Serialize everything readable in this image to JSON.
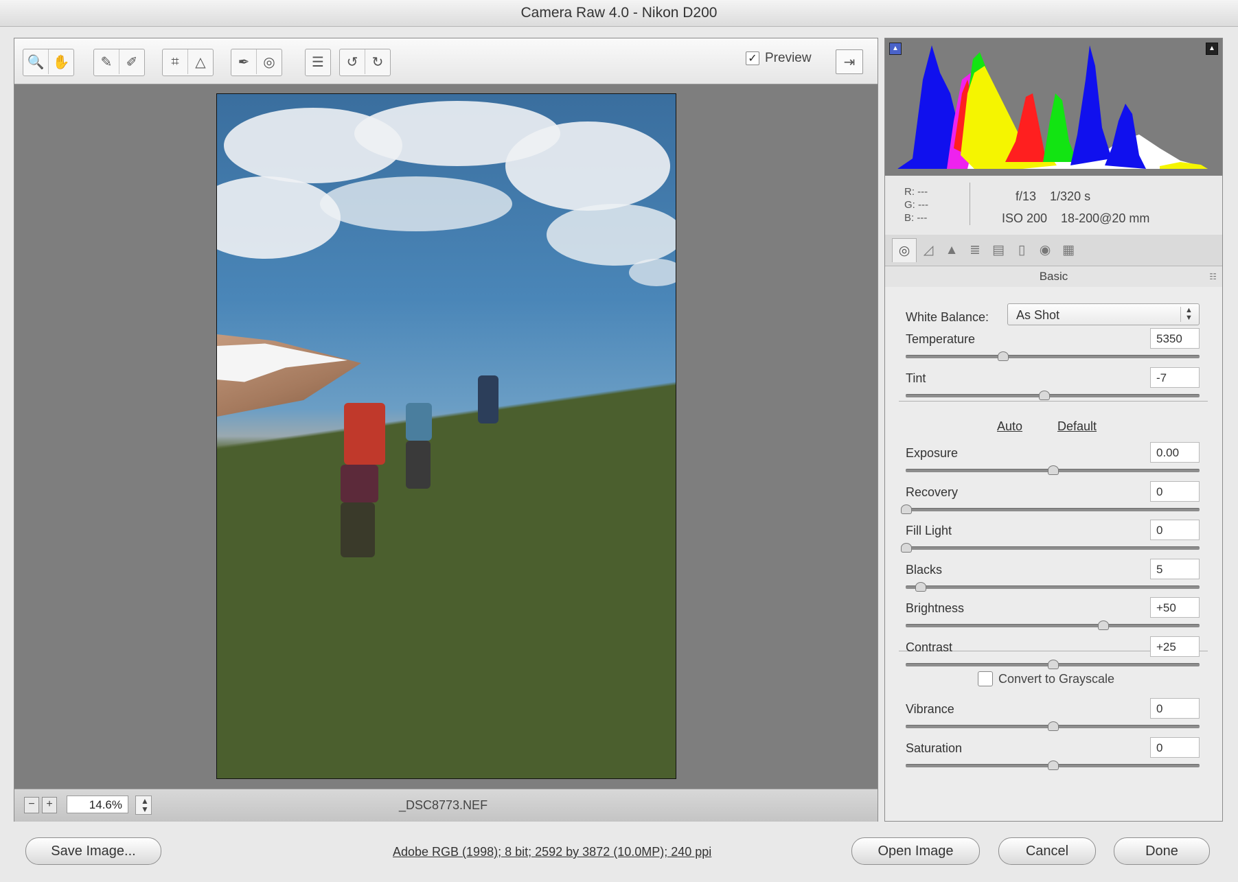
{
  "window": {
    "title": "Camera Raw 4.0  -  Nikon D200"
  },
  "toolbar": {
    "tools": [
      {
        "name": "zoom-tool-icon",
        "glyph": "🔍"
      },
      {
        "name": "hand-tool-icon",
        "glyph": "✋"
      },
      {
        "name": "white-balance-tool-icon",
        "glyph": "✎"
      },
      {
        "name": "color-sampler-tool-icon",
        "glyph": "✐"
      },
      {
        "name": "crop-tool-icon",
        "glyph": "⌗"
      },
      {
        "name": "straighten-tool-icon",
        "glyph": "△"
      },
      {
        "name": "retouch-tool-icon",
        "glyph": "✒"
      },
      {
        "name": "red-eye-tool-icon",
        "glyph": "◎"
      },
      {
        "name": "preferences-icon",
        "glyph": "☰"
      },
      {
        "name": "rotate-left-icon",
        "glyph": "↺"
      },
      {
        "name": "rotate-right-icon",
        "glyph": "↻"
      }
    ],
    "preview_label": "Preview",
    "preview_checked": "✓",
    "fullscreen_glyph": "⇥"
  },
  "preview": {
    "zoom_level": "14.6%",
    "zoom_minus": "−",
    "zoom_plus": "+",
    "stepper": "▲▼",
    "filename": "_DSC8773.NEF"
  },
  "histogram": {
    "clip_shadow_glyph": "▲",
    "clip_highlight_glyph": "▲",
    "colors": {
      "red": "#ff1f1f",
      "green": "#12e412",
      "blue": "#1010ee",
      "yellow": "#f5f500",
      "white": "#ffffff",
      "magenta": "#ee22ee"
    }
  },
  "info": {
    "r_label": "R:",
    "r_value": "---",
    "g_label": "G:",
    "g_value": "---",
    "b_label": "B:",
    "b_value": "---",
    "aperture": "f/13",
    "shutter": "1/320 s",
    "iso": "ISO 200",
    "lens": "18-200@20 mm"
  },
  "panel": {
    "tabs": [
      {
        "name": "tab-basic",
        "glyph": "◎"
      },
      {
        "name": "tab-tone-curve",
        "glyph": "◿"
      },
      {
        "name": "tab-detail",
        "glyph": "▲"
      },
      {
        "name": "tab-hsl",
        "glyph": "≣"
      },
      {
        "name": "tab-split-toning",
        "glyph": "▤"
      },
      {
        "name": "tab-lens-corrections",
        "glyph": "▯"
      },
      {
        "name": "tab-camera-calibration",
        "glyph": "◉"
      },
      {
        "name": "tab-presets",
        "glyph": "▦"
      }
    ],
    "header": "Basic",
    "menu_glyph": "☷",
    "white_balance": {
      "label": "White Balance:",
      "value": "As Shot",
      "arrows": "▲▼"
    },
    "auto_label": "Auto",
    "default_label": "Default",
    "grayscale_label": "Convert to Grayscale",
    "sliders": [
      {
        "key": "temperature",
        "label": "Temperature",
        "value": "5350",
        "pos": 0.33
      },
      {
        "key": "tint",
        "label": "Tint",
        "value": "-7",
        "pos": 0.47
      },
      {
        "key": "exposure",
        "label": "Exposure",
        "value": "0.00",
        "pos": 0.5
      },
      {
        "key": "recovery",
        "label": "Recovery",
        "value": "0",
        "pos": 0.0
      },
      {
        "key": "fill-light",
        "label": "Fill Light",
        "value": "0",
        "pos": 0.0
      },
      {
        "key": "blacks",
        "label": "Blacks",
        "value": "5",
        "pos": 0.05
      },
      {
        "key": "brightness",
        "label": "Brightness",
        "value": "+50",
        "pos": 0.67
      },
      {
        "key": "contrast",
        "label": "Contrast",
        "value": "+25",
        "pos": 0.5
      },
      {
        "key": "vibrance",
        "label": "Vibrance",
        "value": "0",
        "pos": 0.5
      },
      {
        "key": "saturation",
        "label": "Saturation",
        "value": "0",
        "pos": 0.5
      }
    ]
  },
  "footer": {
    "save_label": "Save Image...",
    "profile_info": "Adobe RGB (1998); 8 bit; 2592 by 3872 (10.0MP); 240 ppi",
    "open_label": "Open Image",
    "cancel_label": "Cancel",
    "done_label": "Done"
  }
}
